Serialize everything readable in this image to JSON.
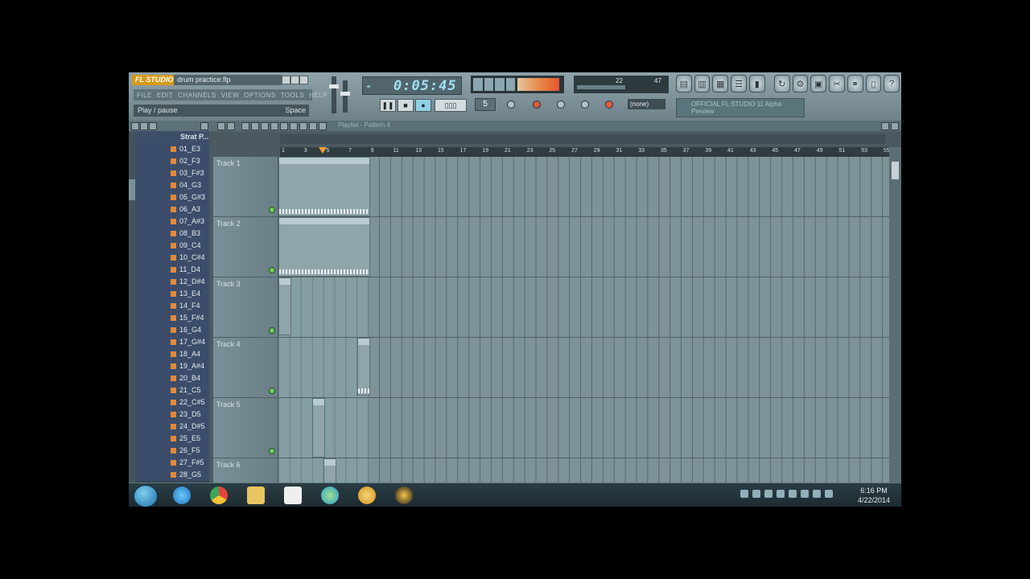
{
  "window": {
    "logo": "FL STUDIO",
    "filename": "drum practice.flp",
    "menu": [
      "FILE",
      "EDIT",
      "CHANNELS",
      "VIEW",
      "OPTIONS",
      "TOOLS",
      "HELP"
    ],
    "hint_text": "Play / pause",
    "hint_key": "Space"
  },
  "transport": {
    "time": "0:05:45",
    "pattern_number": "5",
    "cpu_value_a": "22",
    "cpu_value_b": "47",
    "pattern_select": "(none)",
    "preview_line1": "OFFICIAL FL STUDIO 11 Alpha",
    "preview_line2": "Preview"
  },
  "playlist": {
    "title": "Playlist - Pattern 4",
    "ruler": [
      "1",
      "3",
      "5",
      "7",
      "9",
      "11",
      "13",
      "15",
      "17",
      "19",
      "21",
      "23",
      "25",
      "27",
      "29",
      "31",
      "33",
      "35",
      "37",
      "39",
      "41",
      "43",
      "45",
      "47",
      "49",
      "51",
      "53",
      "55"
    ],
    "tracks": [
      "Track 1",
      "Track 2",
      "Track 3",
      "Track 4",
      "Track 5",
      "Track 6"
    ]
  },
  "browser": {
    "folder": "Strat P...",
    "items": [
      "01_E3",
      "02_F3",
      "03_F#3",
      "04_G3",
      "05_G#3",
      "06_A3",
      "07_A#3",
      "08_B3",
      "09_C4",
      "10_C#4",
      "11_D4",
      "12_D#4",
      "13_E4",
      "14_F4",
      "15_F#4",
      "16_G4",
      "17_G#4",
      "18_A4",
      "19_A#4",
      "20_B4",
      "21_C5",
      "22_C#5",
      "23_D5",
      "24_D#5",
      "25_E5",
      "26_F5",
      "27_F#5",
      "28_G5"
    ]
  },
  "taskbar": {
    "time": "6:16 PM",
    "date": "4/22/2014",
    "apps": [
      "internet-explorer-icon",
      "chrome-icon",
      "folder-icon",
      "apps-icon",
      "network-icon",
      "fl-studio-icon",
      "media-player-icon"
    ]
  },
  "colors": {
    "accent": "#e2893a",
    "time_text": "#9fe0f5",
    "grid": "#7d9398"
  }
}
